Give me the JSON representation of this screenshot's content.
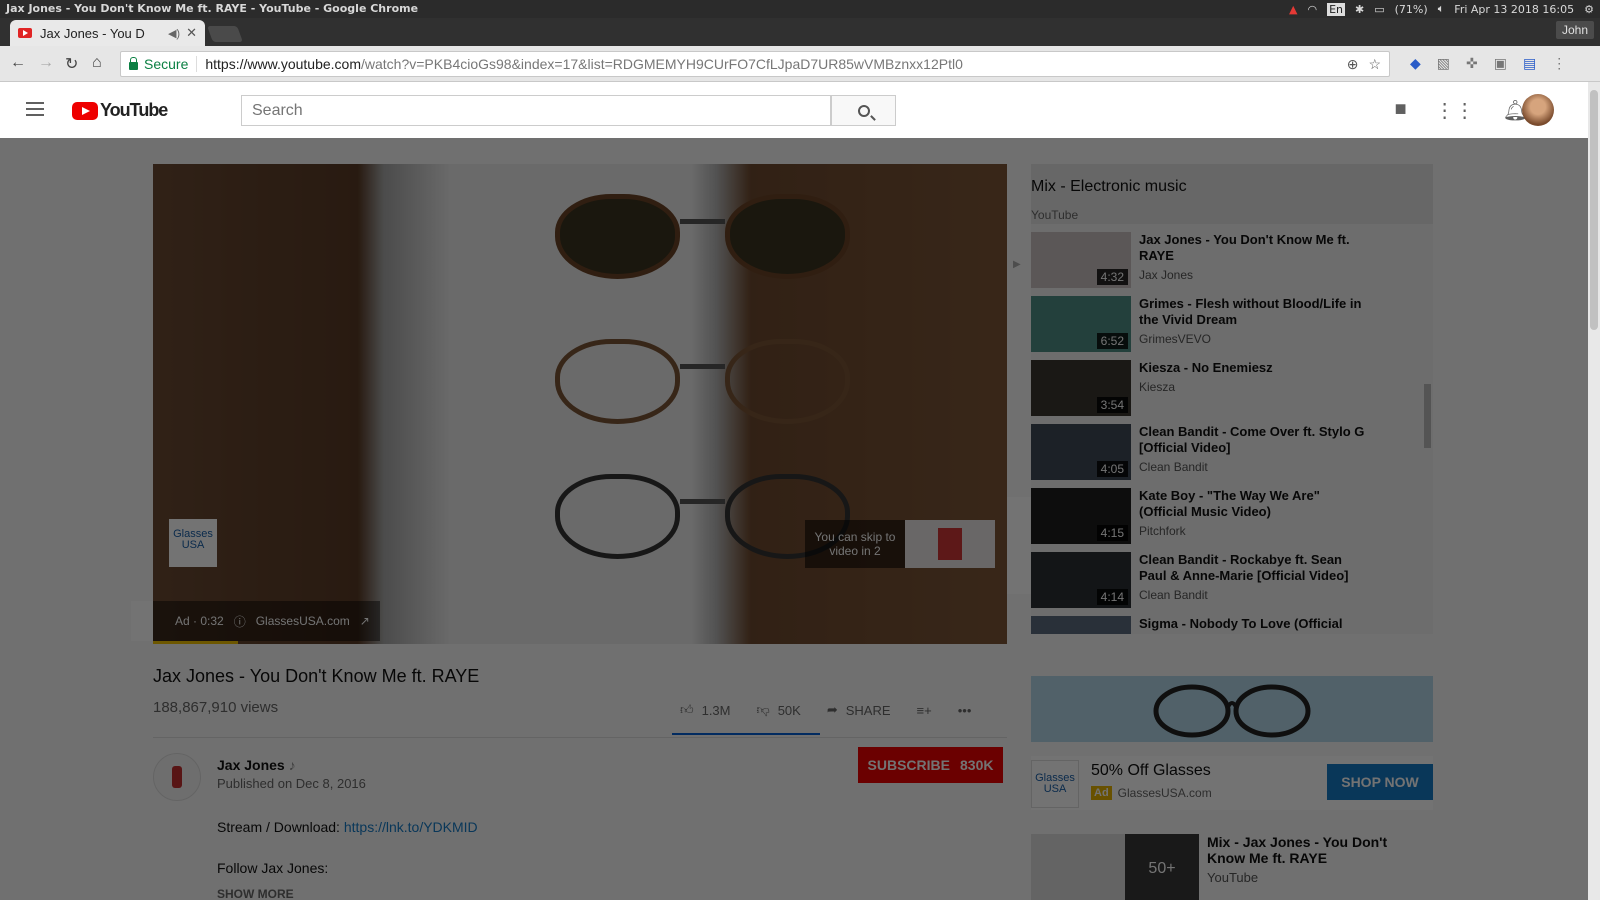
{
  "os": {
    "window_title": "Jax Jones - You Don't Know Me ft. RAYE - YouTube - Google Chrome",
    "battery": "(71%)",
    "lang": "En",
    "datetime": "Fri Apr 13 2018 16:05",
    "user": "John"
  },
  "browser": {
    "tab_title": "Jax Jones - You D",
    "secure_label": "Secure",
    "url_main": "https://www.youtube.com",
    "url_rest": "/watch?v=PKB4cioGs98&index=17&list=RDGMEMYH9CUrFO7CfLJpaD7UR85wVMBznxx12Ptl0"
  },
  "yt": {
    "logo_text": "YouTube",
    "search_placeholder": "Search"
  },
  "player": {
    "ad_label": "Ad · 0:32",
    "ad_domain": "GlassesUSA.com",
    "ad_progress": 0.1,
    "logo_text_1": "Glasses",
    "logo_text_2": "USA",
    "skip_text": "You can skip to video in 2"
  },
  "video": {
    "title": "Jax Jones - You Don't Know Me ft. RAYE",
    "views": "188,867,910 views",
    "likes": "1.3M",
    "dislikes": "50K",
    "share": "SHARE",
    "channel": "Jax Jones",
    "published": "Published on Dec 8, 2016",
    "subscribe": "SUBSCRIBE",
    "subscribers": "830K",
    "desc_prefix": "Stream / Download: ",
    "desc_link": "https://lnk.to/YDKMID",
    "desc_follow": "Follow Jax Jones:",
    "show_more": "SHOW MORE"
  },
  "mix": {
    "title": "Mix - Electronic music",
    "channel": "YouTube",
    "items": [
      {
        "title": "Jax Jones - You Don't Know Me ft. RAYE",
        "channel": "Jax Jones",
        "duration": "4:32",
        "color": "#c9c2c2"
      },
      {
        "title": "Grimes - Flesh without Blood/Life in the Vivid Dream",
        "channel": "GrimesVEVO",
        "duration": "6:52",
        "color": "#4f8f86"
      },
      {
        "title": "Kiesza - No Enemiesz",
        "channel": "Kiesza",
        "duration": "3:54",
        "color": "#3a3530"
      },
      {
        "title": "Clean Bandit - Come Over ft. Stylo G [Official Video]",
        "channel": "Clean Bandit",
        "duration": "4:05",
        "color": "#3e4a58"
      },
      {
        "title": "Kate Boy - \"The Way We Are\" (Official Music Video)",
        "channel": "Pitchfork",
        "duration": "4:15",
        "color": "#1e1e1e"
      },
      {
        "title": "Clean Bandit - Rockabye ft. Sean Paul & Anne-Marie [Official Video]",
        "channel": "Clean Bandit",
        "duration": "4:14",
        "color": "#2c3034"
      },
      {
        "title": "Sigma - Nobody To Love (Official Video) HD",
        "channel": "",
        "duration": "",
        "color": "#5b6b7e"
      }
    ]
  },
  "side_ad": {
    "title": "50% Off Glasses",
    "badge": "Ad",
    "domain": "GlassesUSA.com",
    "button": "SHOP NOW",
    "logo_text_1": "Glasses",
    "logo_text_2": "USA"
  },
  "rec": {
    "title": "Mix - Jax Jones - You Don't Know Me ft. RAYE",
    "channel": "YouTube",
    "count": "50+"
  }
}
